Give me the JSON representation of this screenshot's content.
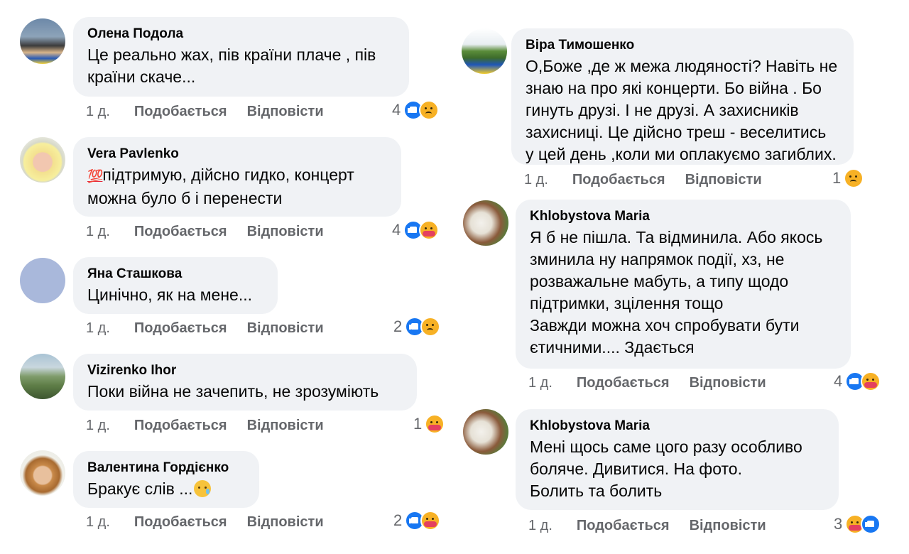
{
  "actions": {
    "time": "1 д.",
    "like": "Подобається",
    "reply": "Відповісти"
  },
  "left_comments": [
    {
      "author": "Олена Подола",
      "text": "Це реально жах, пів країни плаче , пів\nкраїни скаче...",
      "reactions": "4",
      "icons": [
        "like-icon",
        "sad-icon"
      ]
    },
    {
      "author": "Vera Pavlenko",
      "emoji": "💯",
      "text": "підтримую, дійсно гидко, концерт\nможна було б і перенести",
      "reactions": "4",
      "icons": [
        "like-icon",
        "care-icon"
      ]
    },
    {
      "author": "Яна Сташкова",
      "text": "Цинічно, як на мене...",
      "reactions": "2",
      "icons": [
        "like-icon",
        "sad-icon"
      ]
    },
    {
      "author": "Vizirenko Ihor",
      "text": "Поки війна не зачепить, не зрозуміють",
      "reactions": "1",
      "icons": [
        "care-icon"
      ]
    },
    {
      "author": "Валентина Гордієнко",
      "text": "Бракує слів  ...",
      "reactions": "2",
      "icons": [
        "like-icon",
        "care-icon"
      ]
    }
  ],
  "right_comments": [
    {
      "author": "Віра Тимошенко",
      "text": "О,Боже ,де ж межа людяності? Навіть не\nзнаю на про які концерти. Бо війна . Бо\nгинуть друзі. І не друзі. А захисників\nзахисниці. Це дійсно треш - веселитись\nу цей день ,коли ми оплакуємо загиблих.",
      "reactions": "1",
      "icons": [
        "sad-icon"
      ]
    },
    {
      "author": "Khlobystova Maria",
      "text": "Я б не пішла. Та відминила. Або якось\nзминила ну напрямок події, хз, не\nрозважальне мабуть, а типу щодо\nпідтримки, зцілення тощо\nЗавжди можна хоч спробувати бути\nєтичними.... Здається",
      "reactions": "4",
      "icons": [
        "like-icon",
        "care-icon"
      ]
    },
    {
      "author": "Khlobystova Maria",
      "text": "Мені щось саме цого разу особливо\nболяче. Дивитися. На фото.\nБолить та болить",
      "reactions": "3",
      "icons": [
        "care-icon",
        "like-icon"
      ]
    }
  ],
  "colors": {
    "bubble": "#f0f2f5",
    "meta": "#65676b",
    "like": "#1877f2",
    "text": "#050505"
  }
}
